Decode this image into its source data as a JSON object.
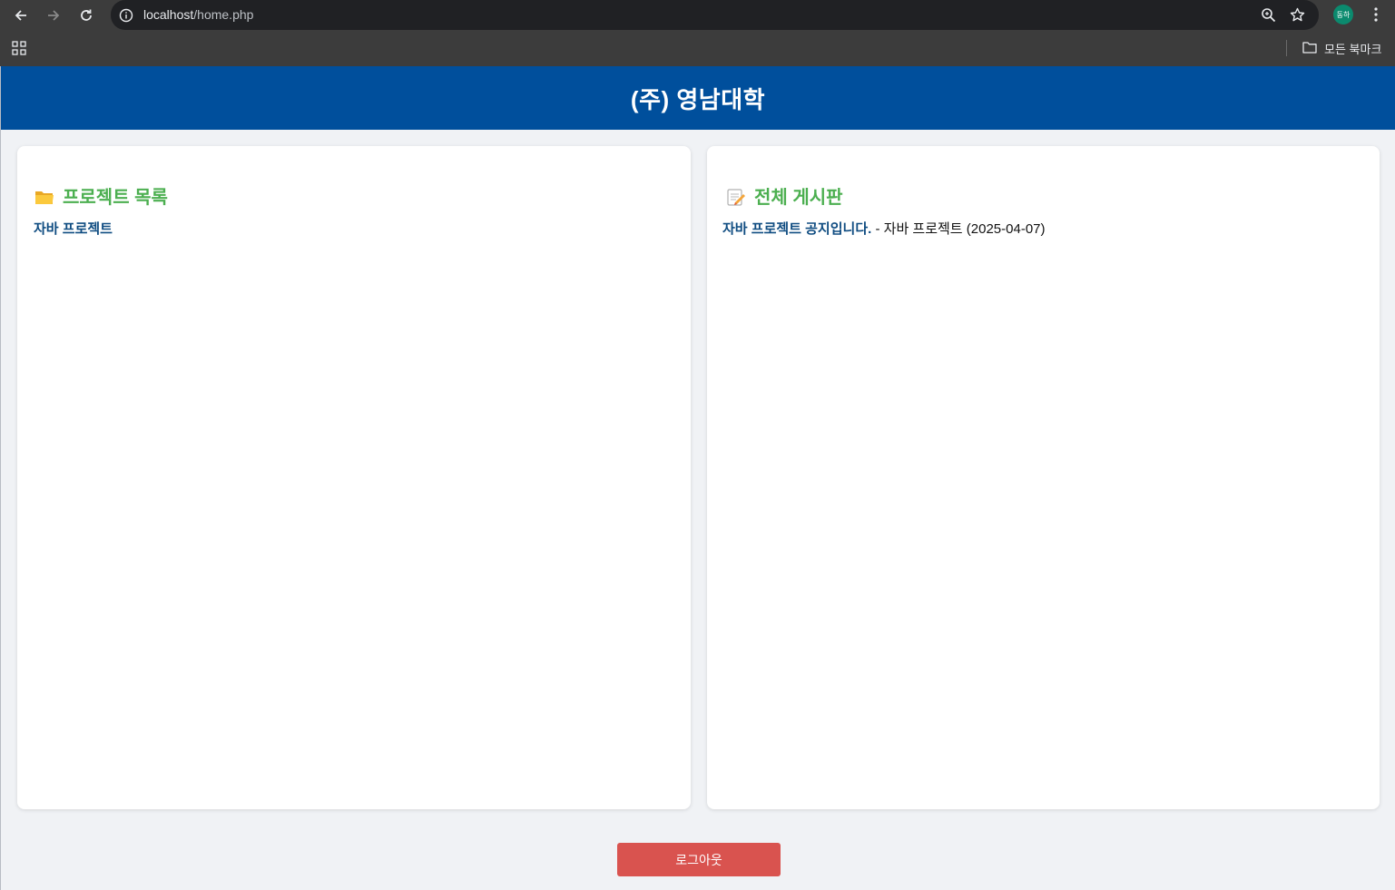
{
  "browser": {
    "url_host": "localhost",
    "url_path": "/home.php",
    "profile_initials": "동하",
    "bookmarks_label": "모든 북마크"
  },
  "header": {
    "title": "(주) 영남대학"
  },
  "projects": {
    "heading": "프로젝트 목록",
    "icon": "folder-icon",
    "items": [
      {
        "label": "자바 프로젝트"
      }
    ]
  },
  "board": {
    "heading": "전체 게시판",
    "icon": "memo-icon",
    "posts": [
      {
        "title": "자바 프로젝트 공지입니다.",
        "meta": " - 자바 프로젝트 (2025-04-07)"
      }
    ]
  },
  "actions": {
    "logout_label": "로그아웃"
  },
  "colors": {
    "header_bg": "#004f9c",
    "heading_green": "#4caf50",
    "link_blue": "#0f4c81",
    "logout_red": "#d9534f",
    "page_bg": "#f0f2f5"
  }
}
